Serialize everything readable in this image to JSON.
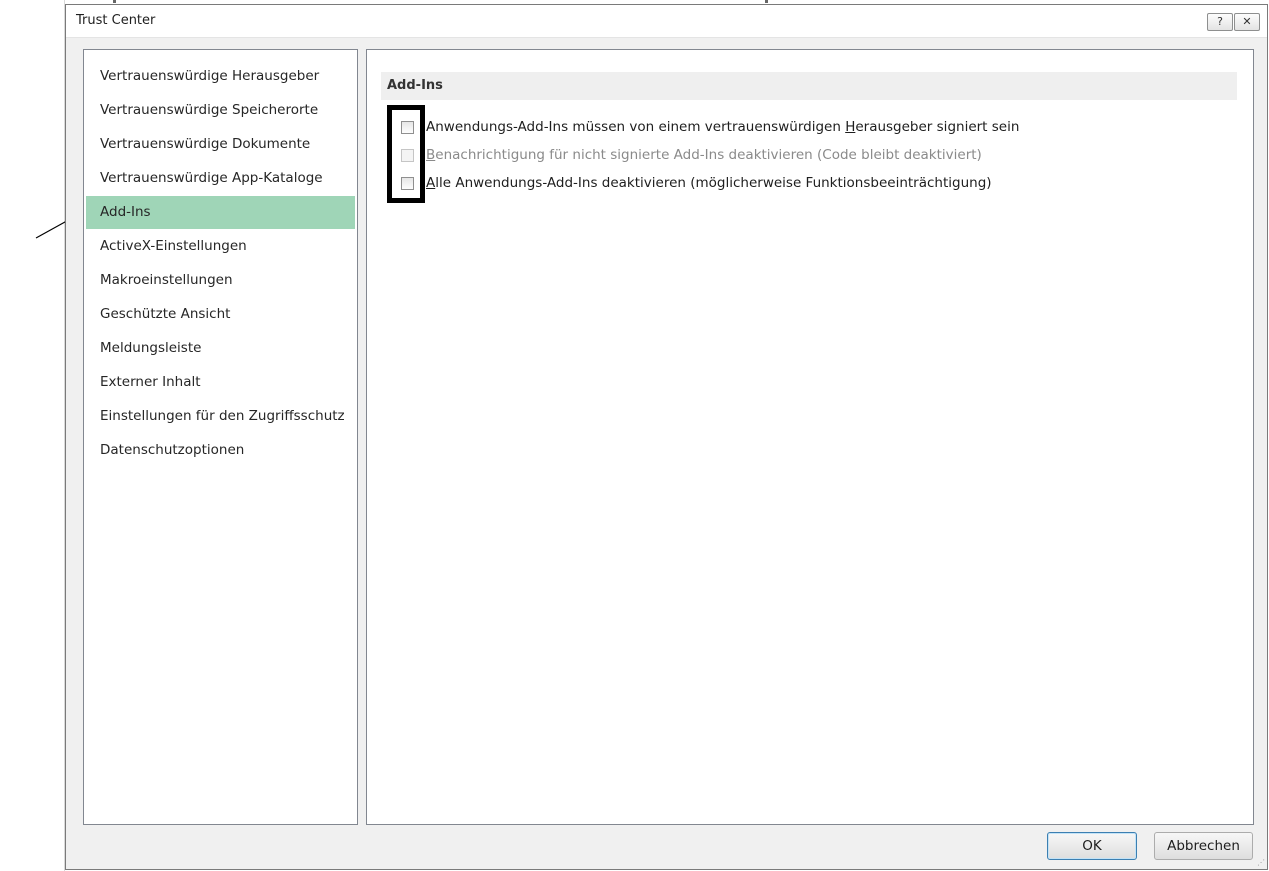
{
  "window": {
    "title": "Trust Center",
    "help_button": "?",
    "close_button": "✕"
  },
  "sidebar": {
    "items": [
      {
        "label": "Vertrauenswürdige Herausgeber",
        "selected": false
      },
      {
        "label": "Vertrauenswürdige Speicherorte",
        "selected": false
      },
      {
        "label": "Vertrauenswürdige Dokumente",
        "selected": false
      },
      {
        "label": "Vertrauenswürdige App-Kataloge",
        "selected": false
      },
      {
        "label": "Add-Ins",
        "selected": true
      },
      {
        "label": "ActiveX-Einstellungen",
        "selected": false
      },
      {
        "label": "Makroeinstellungen",
        "selected": false
      },
      {
        "label": "Geschützte Ansicht",
        "selected": false
      },
      {
        "label": "Meldungsleiste",
        "selected": false
      },
      {
        "label": "Externer Inhalt",
        "selected": false
      },
      {
        "label": "Einstellungen für den Zugriffsschutz",
        "selected": false
      },
      {
        "label": "Datenschutzoptionen",
        "selected": false
      }
    ]
  },
  "content": {
    "section_title": "Add-Ins",
    "options": [
      {
        "pre": "Anwendungs-Add-Ins müssen von einem vertrauenswürdigen ",
        "accel": "H",
        "post": "erausgeber signiert sein",
        "checked": false,
        "enabled": true
      },
      {
        "pre": "",
        "accel": "B",
        "post": "enachrichtigung für nicht signierte Add-Ins deaktivieren (Code bleibt deaktiviert)",
        "checked": false,
        "enabled": false
      },
      {
        "pre": "",
        "accel": "A",
        "post": "lle Anwendungs-Add-Ins deaktivieren (möglicherweise Funktionsbeeinträchtigung)",
        "checked": false,
        "enabled": true
      }
    ]
  },
  "footer": {
    "ok_label": "OK",
    "cancel_label": "Abbrechen"
  },
  "colors": {
    "selected_item": "#9fd5b7",
    "section_header": "#efefef",
    "dialog_bg": "#f0f0f0"
  }
}
